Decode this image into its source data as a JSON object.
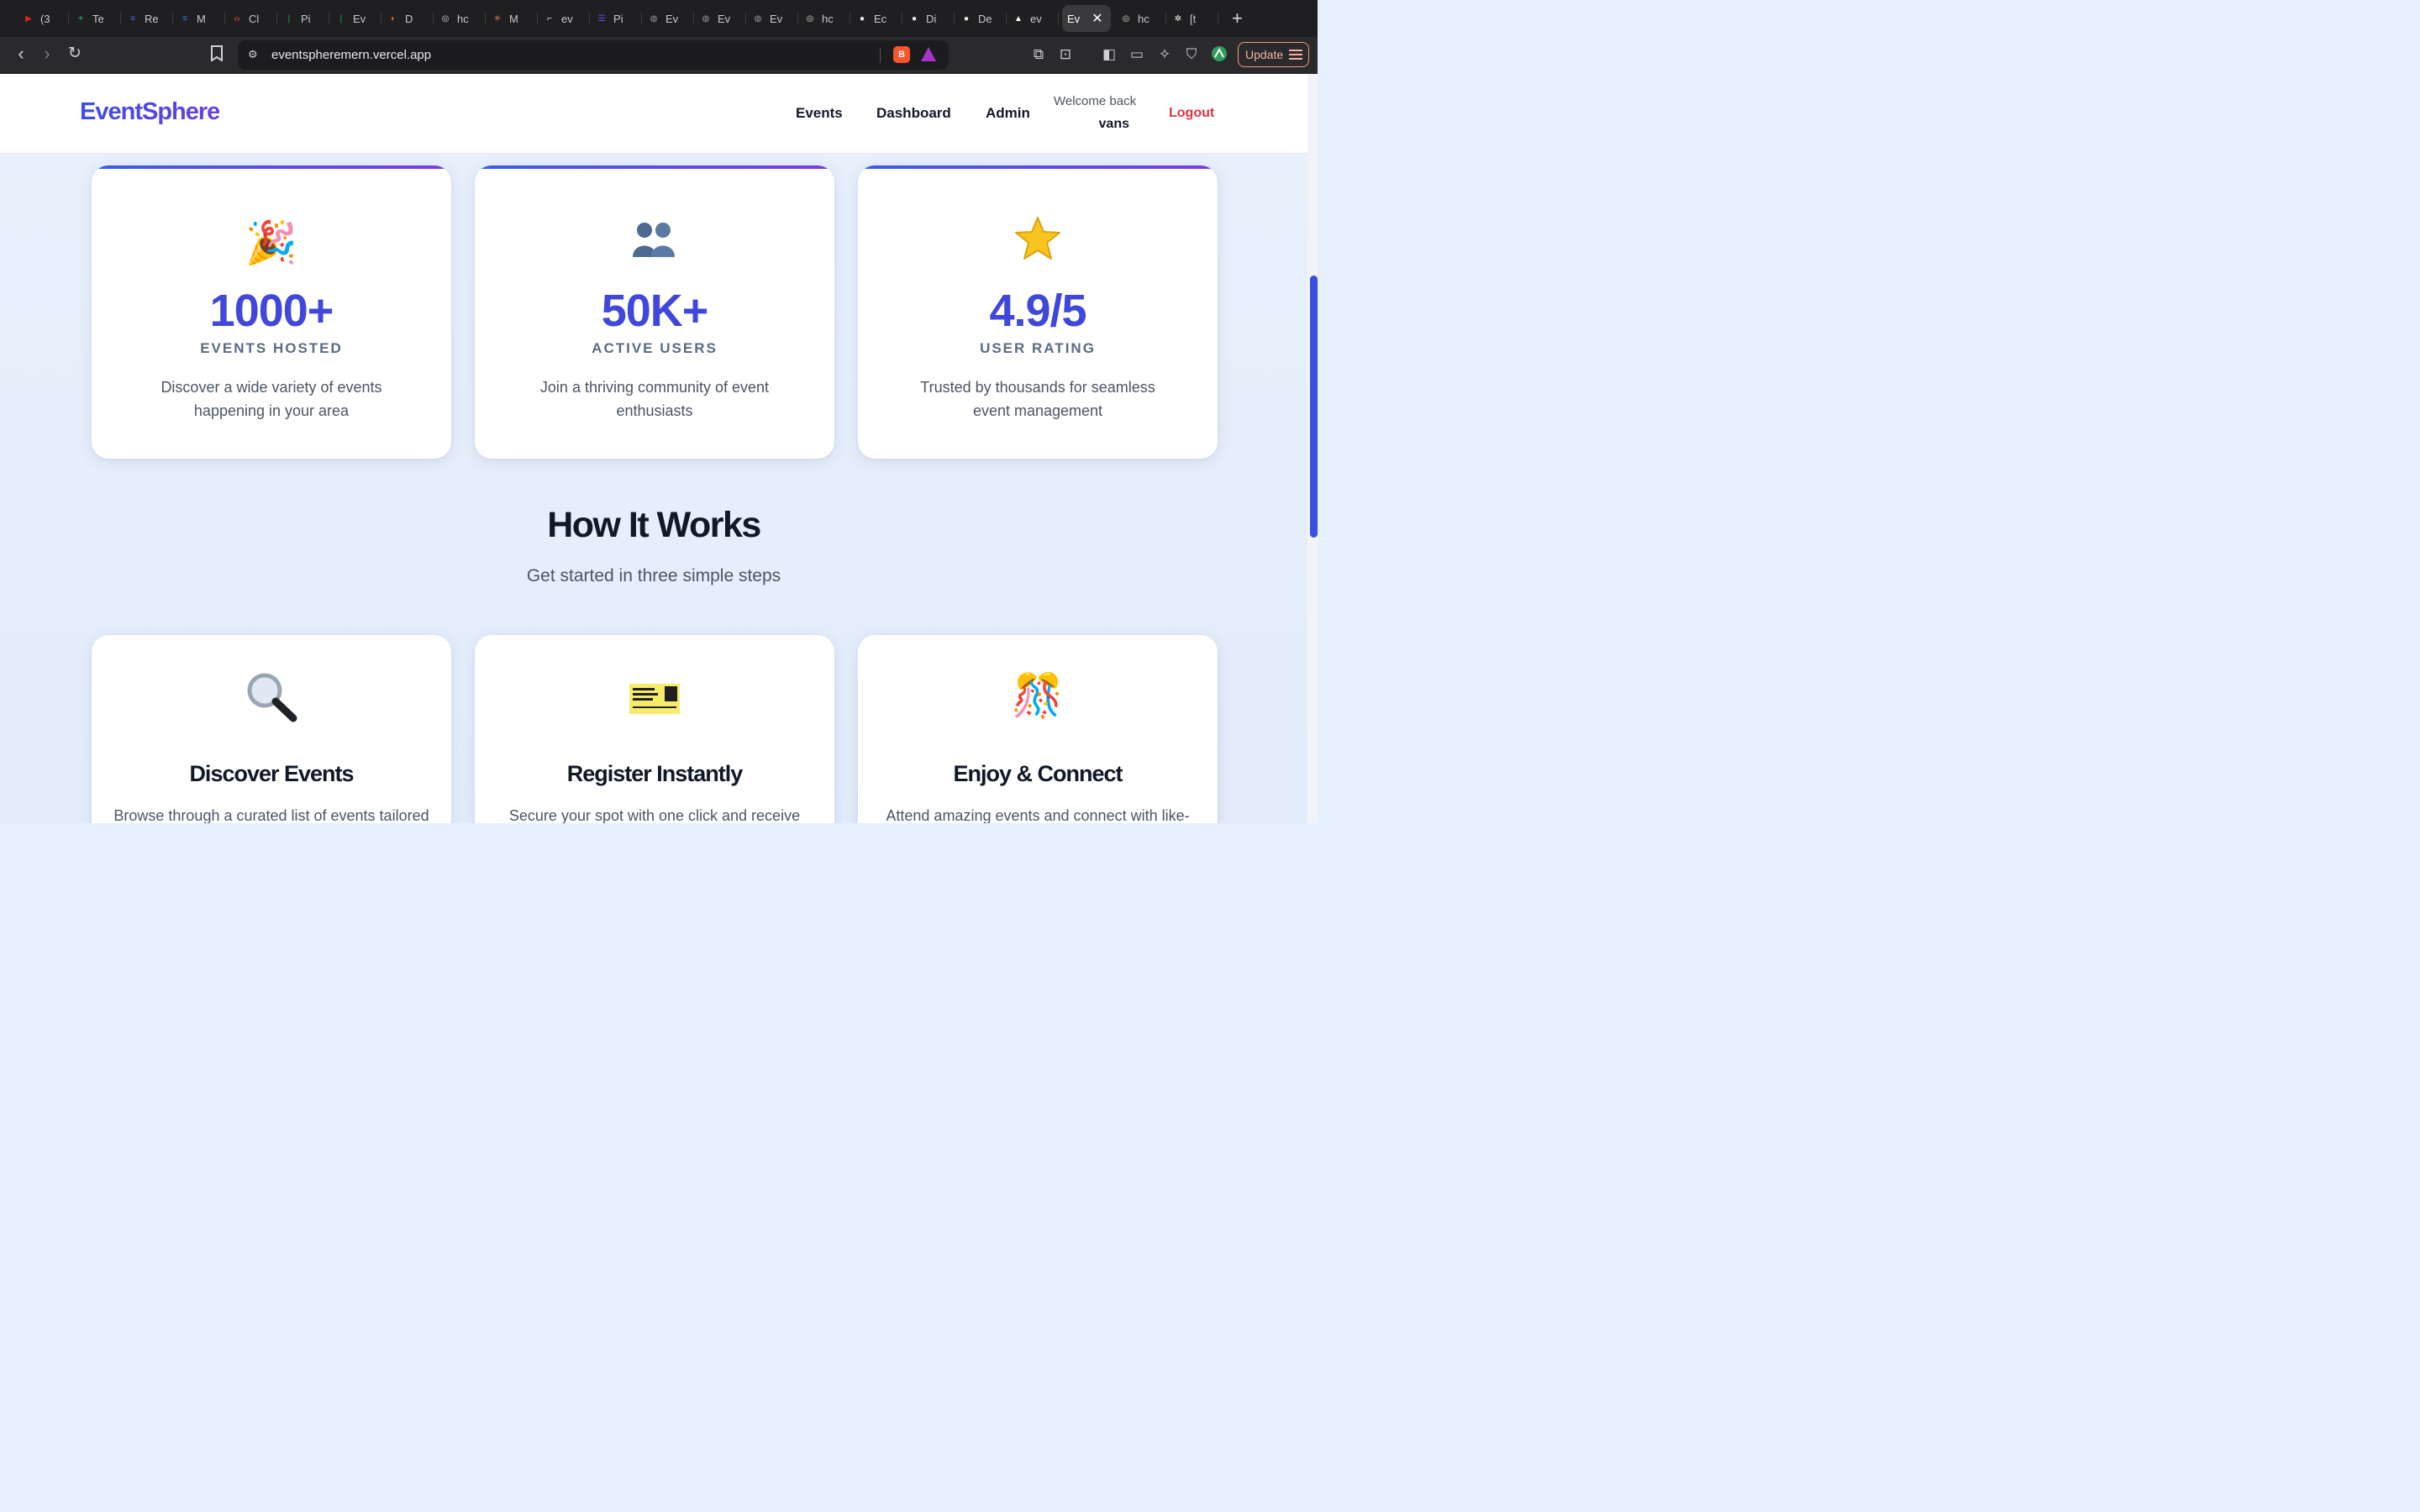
{
  "browser": {
    "tabs": [
      {
        "label": "(3",
        "color": "#e62117",
        "glyph": "▶"
      },
      {
        "label": "Te",
        "color": "#1fa463",
        "glyph": "+"
      },
      {
        "label": "Re",
        "color": "#4a6cf7",
        "glyph": "≡"
      },
      {
        "label": "M",
        "color": "#4a6cf7",
        "glyph": "≡"
      },
      {
        "label": "Cl",
        "color": "#e64a2e",
        "glyph": "‹›"
      },
      {
        "label": "Pi",
        "color": "#13aa52",
        "glyph": "❘"
      },
      {
        "label": "Ev",
        "color": "#13aa52",
        "glyph": "❘"
      },
      {
        "label": "D",
        "color": "#f26a2e",
        "glyph": "◐"
      },
      {
        "label": "hc",
        "color": "#d9d9d9",
        "glyph": "◎"
      },
      {
        "label": "M",
        "color": "#d97757",
        "glyph": "✳"
      },
      {
        "label": "ev",
        "color": "#ffffff",
        "glyph": "⌐"
      },
      {
        "label": "Pi",
        "color": "#6b4ce6",
        "glyph": "☰"
      },
      {
        "label": "Ev",
        "color": "#9a9aa0",
        "glyph": "◍"
      },
      {
        "label": "Ev",
        "color": "#9a9aa0",
        "glyph": "◍"
      },
      {
        "label": "Ev",
        "color": "#9a9aa0",
        "glyph": "◍"
      },
      {
        "label": "hc",
        "color": "#d9d9d9",
        "glyph": "◎"
      },
      {
        "label": "Ec",
        "color": "#ffffff",
        "glyph": "●"
      },
      {
        "label": "Di",
        "color": "#ffffff",
        "glyph": "●"
      },
      {
        "label": "De",
        "color": "#ffffff",
        "glyph": "●"
      },
      {
        "label": "ev",
        "color": "#ffffff",
        "glyph": "▲"
      }
    ],
    "active_tab": {
      "label": "Ev"
    },
    "after_tabs": [
      {
        "label": "hc",
        "color": "#d9d9d9",
        "glyph": "◎"
      },
      {
        "label": "[t",
        "color": "#ffffff",
        "glyph": "✲"
      }
    ],
    "url": "eventspheremern.vercel.app",
    "update_label": "Update"
  },
  "header": {
    "brand": "EventSphere",
    "nav": [
      "Events",
      "Dashboard",
      "Admin"
    ],
    "welcome": "Welcome back",
    "username": "vans",
    "logout": "Logout"
  },
  "stats": [
    {
      "icon": "🎉",
      "icon_name": "party-popper-icon",
      "value": "1000+",
      "label": "EVENTS HOSTED",
      "desc": "Discover a wide variety of events happening in your area"
    },
    {
      "icon": "👥",
      "icon_name": "users-icon",
      "value": "50K+",
      "label": "ACTIVE USERS",
      "desc": "Join a thriving community of event enthusiasts"
    },
    {
      "icon": "⭐",
      "icon_name": "star-icon",
      "value": "4.9/5",
      "label": "USER RATING",
      "desc": "Trusted by thousands for seamless event management"
    }
  ],
  "how": {
    "title": "How It Works",
    "subtitle": "Get started in three simple steps"
  },
  "steps": [
    {
      "icon": "🔍",
      "icon_name": "magnifier-icon",
      "title": "Discover Events",
      "desc": "Browse through a curated list of events tailored"
    },
    {
      "icon": "🎫",
      "icon_name": "ticket-icon",
      "title": "Register Instantly",
      "desc": "Secure your spot with one click and receive"
    },
    {
      "icon": "🎊",
      "icon_name": "confetti-ball-icon",
      "title": "Enjoy & Connect",
      "desc": "Attend amazing events and connect with like-"
    }
  ],
  "colors": {
    "accent": "#3f47dd",
    "logout": "#e0343e",
    "scroll_thumb": "#3a4fe0"
  }
}
